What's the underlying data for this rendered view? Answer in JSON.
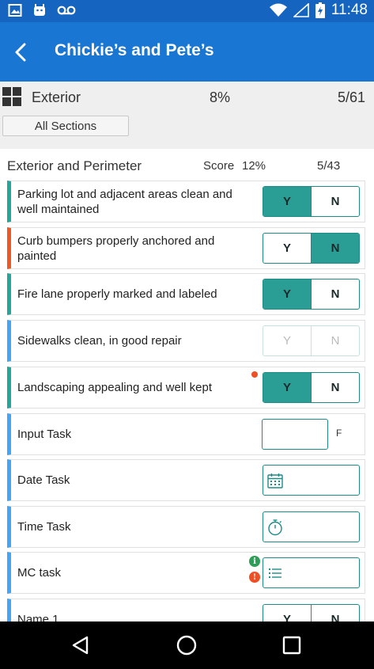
{
  "status_bar": {
    "time": "11:48"
  },
  "header": {
    "title": "Chickie’s and Pete’s"
  },
  "section": {
    "name": "Exterior",
    "percent": "8%",
    "count": "5/61",
    "all_sections_label": "All Sections"
  },
  "group": {
    "title": "Exterior and Perimeter",
    "score_label": "Score",
    "score_percent": "12%",
    "count": "5/43"
  },
  "tasks": [
    {
      "label": "Parking lot and adjacent areas clean and well maintained",
      "yes": "Y",
      "no": "N",
      "selected": "Y"
    },
    {
      "label": "Curb bumpers properly anchored and painted",
      "yes": "Y",
      "no": "N",
      "selected": "N"
    },
    {
      "label": "Fire lane properly marked and labeled",
      "yes": "Y",
      "no": "N",
      "selected": "Y"
    },
    {
      "label": "Sidewalks clean, in good repair",
      "yes": "Y",
      "no": "N",
      "selected": "none"
    },
    {
      "label": "Landscaping appealing and well kept",
      "yes": "Y",
      "no": "N",
      "selected": "Y"
    },
    {
      "label": "Input Task",
      "value": "",
      "unit": "F"
    },
    {
      "label": "Date Task",
      "value": ""
    },
    {
      "label": "Time Task",
      "value": ""
    },
    {
      "label": "MC task",
      "value": ""
    },
    {
      "label": "Name 1",
      "yes": "Y",
      "no": "N",
      "selected": "none"
    }
  ],
  "colors": {
    "status_bar": "#1565c0",
    "app_bar": "#1976d2",
    "accent": "#2a9d94",
    "alert": "#f04e23",
    "info": "#2e9d57"
  }
}
